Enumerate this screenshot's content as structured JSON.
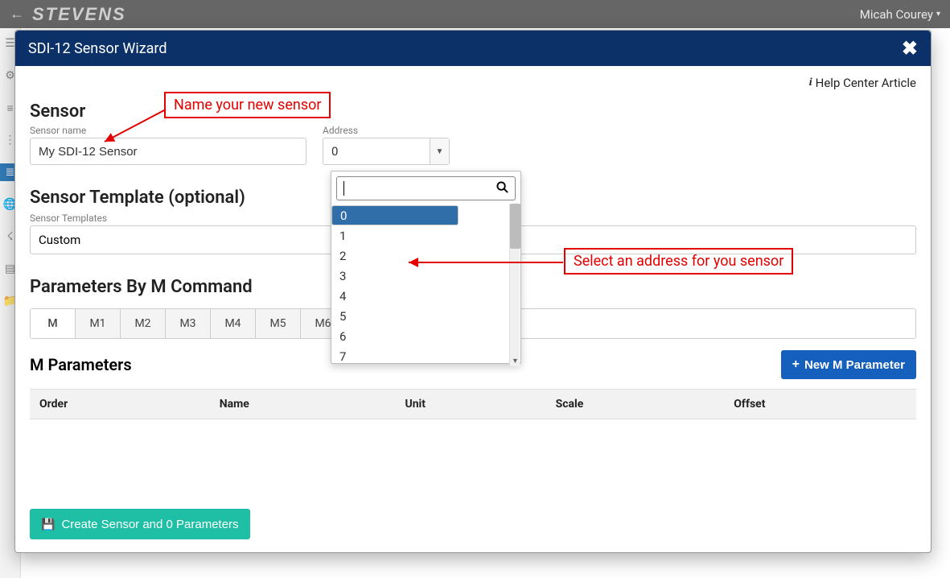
{
  "topbar": {
    "logo_text": "STEVENS",
    "user_name": "Micah Courey"
  },
  "modal": {
    "title": "SDI-12 Sensor Wizard",
    "help_link": "Help Center Article",
    "sections": {
      "sensor_heading": "Sensor",
      "sensor_name_label": "Sensor name",
      "sensor_name_value": "My SDI-12 Sensor",
      "address_label": "Address",
      "address_value": "0",
      "template_heading": "Sensor Template (optional)",
      "template_label": "Sensor Templates",
      "template_value": "Custom",
      "params_heading": "Parameters By M Command",
      "m_tabs": [
        "M",
        "M1",
        "M2",
        "M3",
        "M4",
        "M5",
        "M6"
      ],
      "m_active_idx": 0,
      "m_params_heading": "M Parameters",
      "new_param_button": "New M Parameter",
      "table_headers": [
        "Order",
        "Name",
        "Unit",
        "Scale",
        "Offset"
      ],
      "create_button": "Create Sensor and 0 Parameters"
    },
    "address_options": [
      "0",
      "1",
      "2",
      "3",
      "4",
      "5",
      "6",
      "7"
    ]
  },
  "annotations": {
    "name_callout": "Name your new sensor",
    "address_callout": "Select an address for you sensor"
  }
}
